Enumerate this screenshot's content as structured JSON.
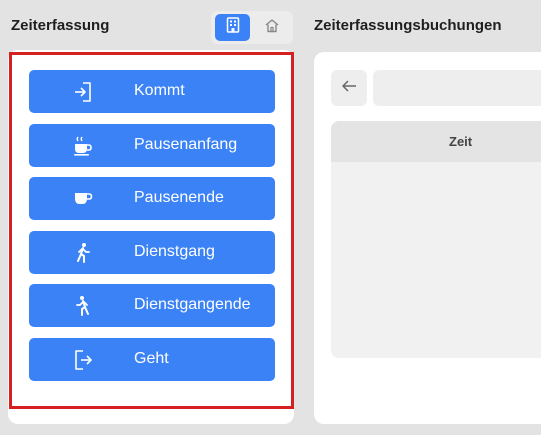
{
  "left_panel": {
    "title": "Zeiterfassung",
    "view_toggle": [
      {
        "icon": "building-icon",
        "active": true
      },
      {
        "icon": "home-icon",
        "active": false
      }
    ],
    "actions": [
      {
        "label": "Kommt",
        "icon": "login-icon"
      },
      {
        "label": "Pausenanfang",
        "icon": "hot-coffee-icon"
      },
      {
        "label": "Pausenende",
        "icon": "coffee-cup-icon"
      },
      {
        "label": "Dienstgang",
        "icon": "walking-icon"
      },
      {
        "label": "Dienstgangende",
        "icon": "walking-icon"
      },
      {
        "label": "Geht",
        "icon": "logout-icon"
      }
    ]
  },
  "right_panel": {
    "title": "Zeiterfassungsbuchungen",
    "back_icon": "arrow-left-icon",
    "date_field_value": "",
    "table": {
      "columns": [
        "Zeit"
      ]
    }
  },
  "colors": {
    "accent": "#3b82f6",
    "highlight": "#d42020",
    "background": "#e3e3e3",
    "card": "#ffffff"
  }
}
